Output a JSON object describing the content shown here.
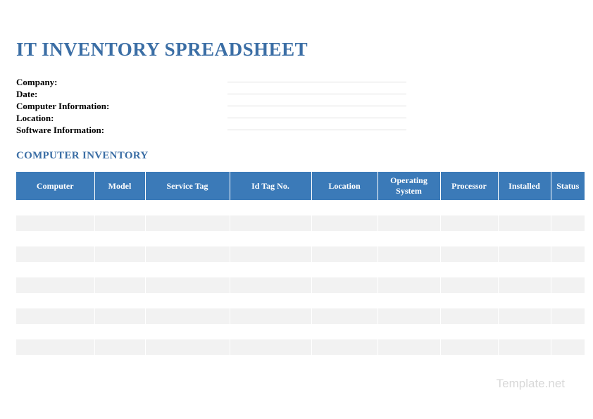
{
  "title": "IT INVENTORY SPREADSHEET",
  "info": {
    "company_label": "Company:",
    "date_label": "Date:",
    "computer_info_label": "Computer Information:",
    "location_label": "Location:",
    "software_info_label": "Software Information:"
  },
  "section_heading": "COMPUTER INVENTORY",
  "table": {
    "headers": {
      "computer": "Computer",
      "model": "Model",
      "service_tag": "Service Tag",
      "id_tag": "Id Tag No.",
      "location": "Location",
      "operating_system": "Operating System",
      "processor": "Processor",
      "installed": "Installed",
      "status": "Status"
    },
    "rows": [
      {
        "computer": "",
        "model": "",
        "service_tag": "",
        "id_tag": "",
        "location": "",
        "os": "",
        "processor": "",
        "installed": "",
        "status": ""
      },
      {
        "computer": "",
        "model": "",
        "service_tag": "",
        "id_tag": "",
        "location": "",
        "os": "",
        "processor": "",
        "installed": "",
        "status": ""
      },
      {
        "computer": "",
        "model": "",
        "service_tag": "",
        "id_tag": "",
        "location": "",
        "os": "",
        "processor": "",
        "installed": "",
        "status": ""
      },
      {
        "computer": "",
        "model": "",
        "service_tag": "",
        "id_tag": "",
        "location": "",
        "os": "",
        "processor": "",
        "installed": "",
        "status": ""
      },
      {
        "computer": "",
        "model": "",
        "service_tag": "",
        "id_tag": "",
        "location": "",
        "os": "",
        "processor": "",
        "installed": "",
        "status": ""
      },
      {
        "computer": "",
        "model": "",
        "service_tag": "",
        "id_tag": "",
        "location": "",
        "os": "",
        "processor": "",
        "installed": "",
        "status": ""
      },
      {
        "computer": "",
        "model": "",
        "service_tag": "",
        "id_tag": "",
        "location": "",
        "os": "",
        "processor": "",
        "installed": "",
        "status": ""
      },
      {
        "computer": "",
        "model": "",
        "service_tag": "",
        "id_tag": "",
        "location": "",
        "os": "",
        "processor": "",
        "installed": "",
        "status": ""
      },
      {
        "computer": "",
        "model": "",
        "service_tag": "",
        "id_tag": "",
        "location": "",
        "os": "",
        "processor": "",
        "installed": "",
        "status": ""
      },
      {
        "computer": "",
        "model": "",
        "service_tag": "",
        "id_tag": "",
        "location": "",
        "os": "",
        "processor": "",
        "installed": "",
        "status": ""
      },
      {
        "computer": "",
        "model": "",
        "service_tag": "",
        "id_tag": "",
        "location": "",
        "os": "",
        "processor": "",
        "installed": "",
        "status": ""
      }
    ]
  },
  "watermark": "Template.net"
}
